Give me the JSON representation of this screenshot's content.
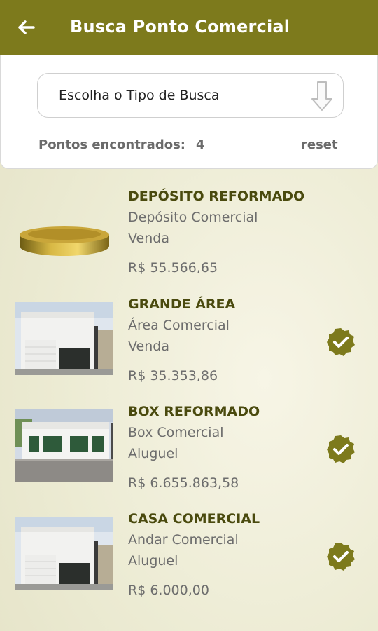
{
  "header": {
    "title": "Busca Ponto Comercial",
    "color": "#7d7a1c"
  },
  "search": {
    "select_value": "Escolha o Tipo de Busca",
    "count_label": "Pontos encontrados:",
    "count_value": "4",
    "reset_label": "reset"
  },
  "items": [
    {
      "title": "DEPÓSITO REFORMADO",
      "type": "Depósito Comercial",
      "deal": "Venda",
      "price": "R$ 55.566,65",
      "image": "gold-disc-thumbnail",
      "verified": false
    },
    {
      "title": "GRANDE ÁREA",
      "type": "Área Comercial",
      "deal": "Venda",
      "price": "R$ 35.353,86",
      "image": "white-building-thumbnail",
      "verified": true
    },
    {
      "title": "BOX REFORMADO",
      "type": "Box Comercial",
      "deal": "Aluguel",
      "price": "R$ 6.655.863,58",
      "image": "storefront-thumbnail",
      "verified": true
    },
    {
      "title": "CASA COMERCIAL",
      "type": "Andar Comercial",
      "deal": "Aluguel",
      "price": "R$ 6.000,00",
      "image": "white-building-thumbnail",
      "verified": true
    }
  ],
  "icons": {
    "back": "arrow-left-icon",
    "dropdown": "arrow-down-icon",
    "verified": "check-badge-icon"
  }
}
